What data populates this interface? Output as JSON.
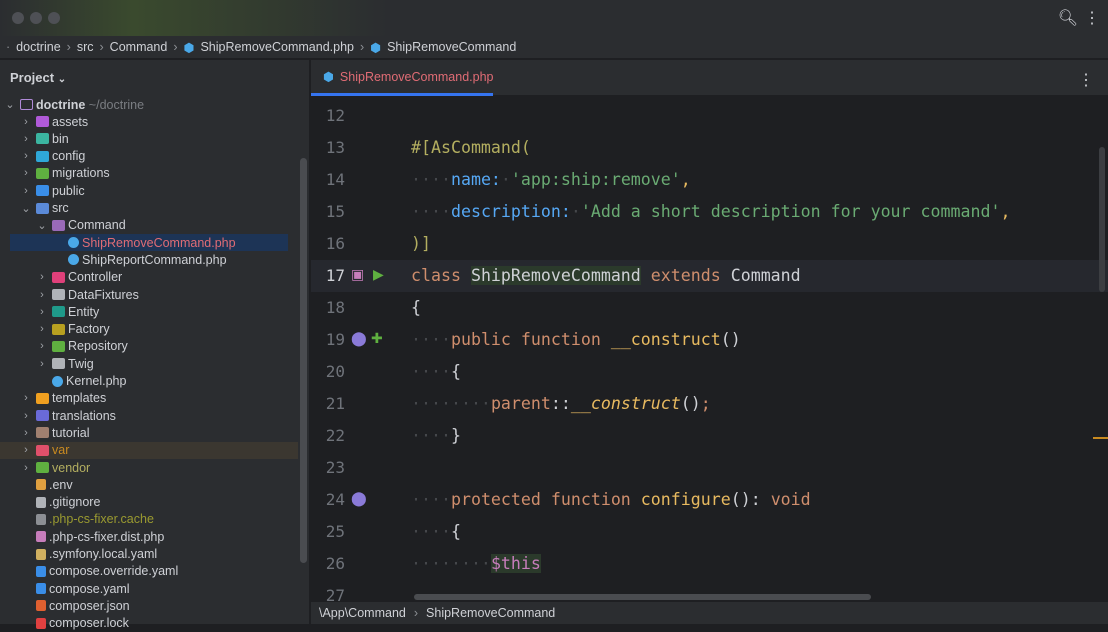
{
  "breadcrumbs": [
    "doctrine",
    "src",
    "Command",
    "ShipRemoveCommand.php",
    "ShipRemoveCommand"
  ],
  "sidebar": {
    "title": "Project",
    "root": {
      "name": "doctrine",
      "path": "~/doctrine"
    },
    "items": [
      {
        "label": "assets",
        "level": 1,
        "type": "folder",
        "color": "#b05ad8",
        "expanded": false
      },
      {
        "label": "bin",
        "level": 1,
        "type": "folder",
        "color": "#3bb5a0",
        "expanded": false
      },
      {
        "label": "config",
        "level": 1,
        "type": "folder",
        "color": "#2fa8d8",
        "expanded": false
      },
      {
        "label": "migrations",
        "level": 1,
        "type": "folder",
        "color": "#5fb040",
        "expanded": false
      },
      {
        "label": "public",
        "level": 1,
        "type": "folder",
        "color": "#3a8ee8",
        "expanded": false
      },
      {
        "label": "src",
        "level": 1,
        "type": "folder",
        "color": "#5b8ad8",
        "expanded": true
      },
      {
        "label": "Command",
        "level": 2,
        "type": "folder",
        "color": "#9a6ab8",
        "expanded": true
      },
      {
        "label": "ShipRemoveCommand.php",
        "level": 3,
        "type": "php",
        "color": "#4aa8e8",
        "selected": true
      },
      {
        "label": "ShipReportCommand.php",
        "level": 3,
        "type": "php",
        "color": "#4aa8e8"
      },
      {
        "label": "Controller",
        "level": 2,
        "type": "folder",
        "color": "#e0407a",
        "expanded": false
      },
      {
        "label": "DataFixtures",
        "level": 2,
        "type": "folder",
        "color": "#b0b3b8",
        "expanded": false
      },
      {
        "label": "Entity",
        "level": 2,
        "type": "folder",
        "color": "#1f9a8a",
        "expanded": false
      },
      {
        "label": "Factory",
        "level": 2,
        "type": "folder",
        "color": "#b8a020",
        "expanded": false
      },
      {
        "label": "Repository",
        "level": 2,
        "type": "folder",
        "color": "#5fb040",
        "expanded": false
      },
      {
        "label": "Twig",
        "level": 2,
        "type": "folder",
        "color": "#b0b3b8",
        "expanded": false
      },
      {
        "label": "Kernel.php",
        "level": 2,
        "type": "php",
        "color": "#4aa8e8"
      },
      {
        "label": "templates",
        "level": 1,
        "type": "folder",
        "color": "#f0a020",
        "expanded": false
      },
      {
        "label": "translations",
        "level": 1,
        "type": "folder",
        "color": "#6a6ad8",
        "expanded": false
      },
      {
        "label": "tutorial",
        "level": 1,
        "type": "folder",
        "color": "#a08070",
        "expanded": false
      },
      {
        "label": "var",
        "level": 1,
        "type": "folder",
        "color": "#e0506a",
        "expanded": false,
        "excluded": true
      },
      {
        "label": "vendor",
        "level": 1,
        "type": "folder",
        "color": "#5fb040",
        "expanded": false,
        "library": true
      },
      {
        "label": ".env",
        "level": 1,
        "type": "file",
        "color": "#e0a040"
      },
      {
        "label": ".gitignore",
        "level": 1,
        "type": "file",
        "color": "#b0b3b8"
      },
      {
        "label": ".php-cs-fixer.cache",
        "level": 1,
        "type": "file",
        "color": "#8c8f94",
        "ignored": true
      },
      {
        "label": ".php-cs-fixer.dist.php",
        "level": 1,
        "type": "file",
        "color": "#c77dbb"
      },
      {
        "label": ".symfony.local.yaml",
        "level": 1,
        "type": "file",
        "color": "#d0b060"
      },
      {
        "label": "compose.override.yaml",
        "level": 1,
        "type": "file",
        "color": "#3a8ee8"
      },
      {
        "label": "compose.yaml",
        "level": 1,
        "type": "file",
        "color": "#3a8ee8"
      },
      {
        "label": "composer.json",
        "level": 1,
        "type": "file",
        "color": "#e06030"
      },
      {
        "label": "composer.lock",
        "level": 1,
        "type": "file",
        "color": "#e04040"
      }
    ]
  },
  "tab": {
    "label": "ShipRemoveCommand.php"
  },
  "editor": {
    "current_line": 17,
    "lines": [
      {
        "n": "12",
        "t": []
      },
      {
        "n": "13",
        "t": [
          [
            "attr",
            "#[AsCommand("
          ]
        ]
      },
      {
        "n": "14",
        "t": [
          [
            "ws",
            "····"
          ],
          [
            "key",
            "name:"
          ],
          [
            "ws",
            "·"
          ],
          [
            "str",
            "'app:ship:remove'"
          ],
          [
            "fn",
            ","
          ]
        ]
      },
      {
        "n": "15",
        "t": [
          [
            "ws",
            "····"
          ],
          [
            "key",
            "description:"
          ],
          [
            "ws",
            "·"
          ],
          [
            "str",
            "'Add a short description for your command'"
          ],
          [
            "fn",
            ","
          ]
        ]
      },
      {
        "n": "16",
        "t": [
          [
            "attr",
            ")]"
          ]
        ]
      },
      {
        "n": "17",
        "t": [
          [
            "kw",
            "class "
          ],
          [
            "cls pl",
            "ShipRemoveCommand"
          ],
          [
            "kw",
            " extends "
          ],
          [
            "pl",
            "Command"
          ]
        ]
      },
      {
        "n": "18",
        "t": [
          [
            "pl",
            "{"
          ]
        ]
      },
      {
        "n": "19",
        "t": [
          [
            "ws",
            "····"
          ],
          [
            "kw",
            "public function "
          ],
          [
            "fn",
            "__construct"
          ],
          [
            "pl",
            "()"
          ]
        ]
      },
      {
        "n": "20",
        "t": [
          [
            "ws",
            "····"
          ],
          [
            "pl",
            "{"
          ]
        ]
      },
      {
        "n": "21",
        "t": [
          [
            "ws",
            "········"
          ],
          [
            "kw",
            "parent"
          ],
          [
            "pl",
            "::"
          ],
          [
            "it",
            "__construct"
          ],
          [
            "pl",
            "()"
          ],
          [
            "kw",
            ";"
          ]
        ]
      },
      {
        "n": "22",
        "t": [
          [
            "ws",
            "····"
          ],
          [
            "pl",
            "}"
          ]
        ]
      },
      {
        "n": "23",
        "t": []
      },
      {
        "n": "24",
        "t": [
          [
            "ws",
            "····"
          ],
          [
            "kw",
            "protected function "
          ],
          [
            "fn",
            "configure"
          ],
          [
            "pl",
            "(): "
          ],
          [
            "kw",
            "void"
          ]
        ]
      },
      {
        "n": "25",
        "t": [
          [
            "ws",
            "····"
          ],
          [
            "pl",
            "{"
          ]
        ]
      },
      {
        "n": "26",
        "t": [
          [
            "ws",
            "········"
          ],
          [
            "var",
            "$this"
          ]
        ]
      },
      {
        "n": "27",
        "t": []
      }
    ]
  },
  "status": {
    "namespace": "\\App\\Command",
    "class": "ShipRemoveCommand"
  }
}
